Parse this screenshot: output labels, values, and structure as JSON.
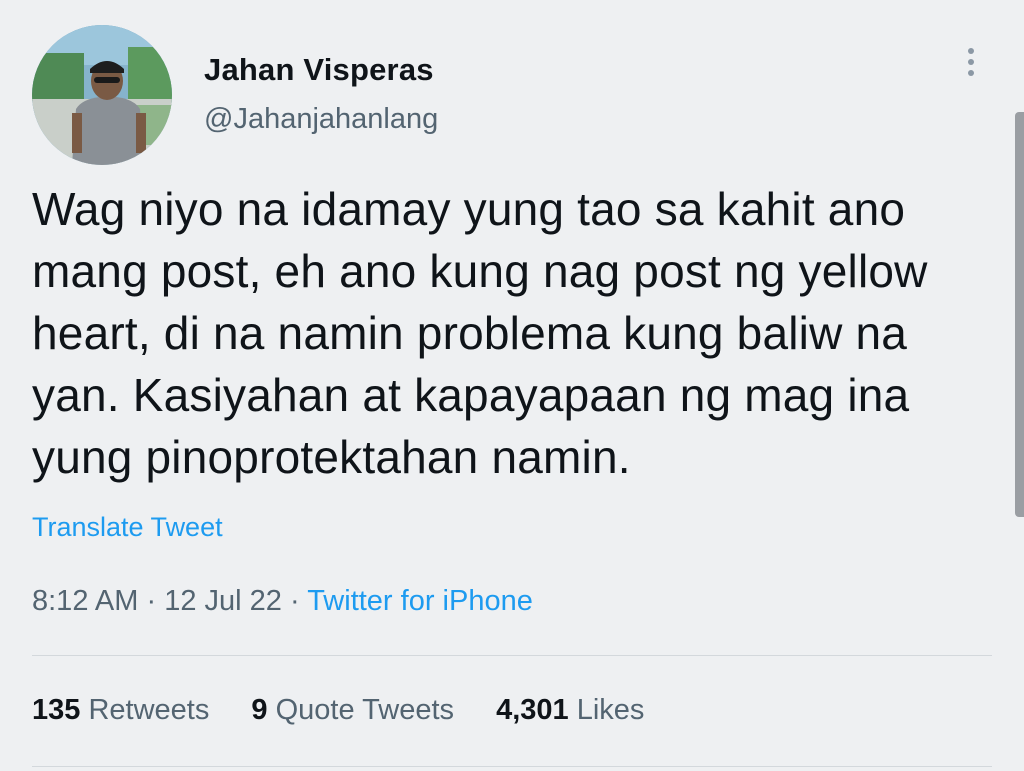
{
  "user": {
    "display_name": "Jahan Visperas",
    "handle": "@Jahanjahanlang",
    "avatar_icon": "profile-photo"
  },
  "tweet": {
    "text": "Wag niyo na idamay yung tao sa kahit ano\nmang post, eh ano kung nag post ng yellow\nheart, di na namin problema kung baliw na\nyan. Kasiyahan at kapayapaan ng mag ina\nyung pinoprotektahan namin.",
    "translate_label": "Translate Tweet",
    "time": "8:12 AM",
    "separator": "·",
    "date": "12 Jul 22",
    "source": "Twitter for iPhone"
  },
  "stats": {
    "retweets_count": "135",
    "retweets_label": "Retweets",
    "quotes_count": "9",
    "quotes_label": "Quote Tweets",
    "likes_count": "4,301",
    "likes_label": "Likes"
  },
  "colors": {
    "link": "#1d9bf0",
    "secondary_text": "#536471",
    "primary_text": "#0f1419",
    "background": "#eef0f2"
  }
}
